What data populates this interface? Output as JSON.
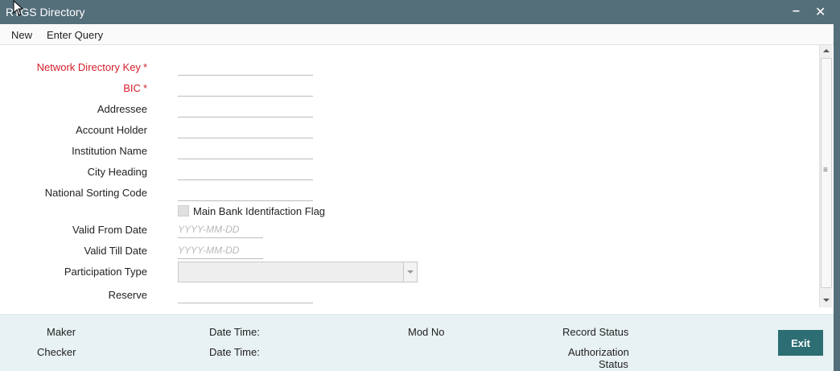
{
  "window": {
    "title": "RTGS Directory",
    "minimize_glyph": "–",
    "close_glyph": "✕"
  },
  "menu": {
    "new_label": "New",
    "enter_query_label": "Enter Query"
  },
  "form": {
    "network_directory_key": {
      "label": "Network Directory Key",
      "required": "*",
      "value": ""
    },
    "bic": {
      "label": "BIC",
      "required": "*",
      "value": ""
    },
    "addressee": {
      "label": "Addressee",
      "value": ""
    },
    "account_holder": {
      "label": "Account Holder",
      "value": ""
    },
    "institution_name": {
      "label": "Institution Name",
      "value": ""
    },
    "city_heading": {
      "label": "City Heading",
      "value": ""
    },
    "national_sorting_code": {
      "label": "National Sorting Code",
      "value": ""
    },
    "main_bank_flag": {
      "label": "Main Bank Identifaction Flag",
      "checked": false
    },
    "valid_from_date": {
      "label": "Valid From Date",
      "placeholder": "YYYY-MM-DD"
    },
    "valid_till_date": {
      "label": "Valid Till Date",
      "placeholder": "YYYY-MM-DD"
    },
    "participation_type": {
      "label": "Participation Type",
      "value": ""
    },
    "reserve": {
      "label": "Reserve",
      "value": ""
    }
  },
  "footer": {
    "maker": "Maker",
    "checker": "Checker",
    "date_time_1": "Date Time:",
    "date_time_2": "Date Time:",
    "mod_no": "Mod No",
    "record_status": "Record Status",
    "authorization_status": "Authorization",
    "authorization_status_2": "Status",
    "exit_label": "Exit"
  },
  "colors": {
    "titlebar": "#546e7a",
    "required": "#d41e2b",
    "footer_bg": "#e8f1f3",
    "exit_button": "#2c6e73"
  }
}
